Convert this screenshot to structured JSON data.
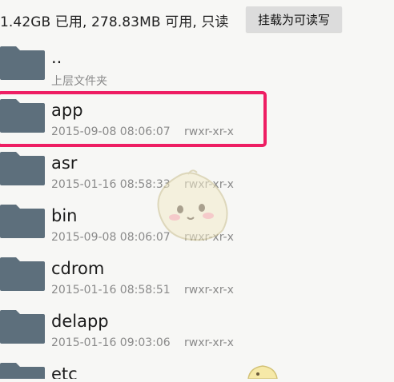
{
  "header": {
    "storage_info": "1.42GB 已用, 278.83MB 可用, 只读",
    "mount_button_label": "挂载为可读写"
  },
  "files": [
    {
      "name": "..",
      "subtitle": "上层文件夹",
      "date": "",
      "perm": ""
    },
    {
      "name": "app",
      "subtitle": "",
      "date": "2015-09-08 08:06:07",
      "perm": "rwxr-xr-x"
    },
    {
      "name": "asr",
      "subtitle": "",
      "date": "2015-01-16 08:58:33",
      "perm": "rwxr-xr-x"
    },
    {
      "name": "bin",
      "subtitle": "",
      "date": "2015-09-08 08:06:07",
      "perm": "rwxr-xr-x"
    },
    {
      "name": "cdrom",
      "subtitle": "",
      "date": "2015-01-16 08:58:51",
      "perm": "rwxr-xr-x"
    },
    {
      "name": "delapp",
      "subtitle": "",
      "date": "2015-01-16 09:03:06",
      "perm": "rwxr-xr-x"
    },
    {
      "name": "etc",
      "subtitle": "",
      "date": "",
      "perm": ""
    }
  ],
  "colors": {
    "folder": "#5d6f7c",
    "highlight": "#ee1e63",
    "button_bg": "#dcdcdc"
  },
  "icons": {
    "folder": "folder-icon"
  }
}
